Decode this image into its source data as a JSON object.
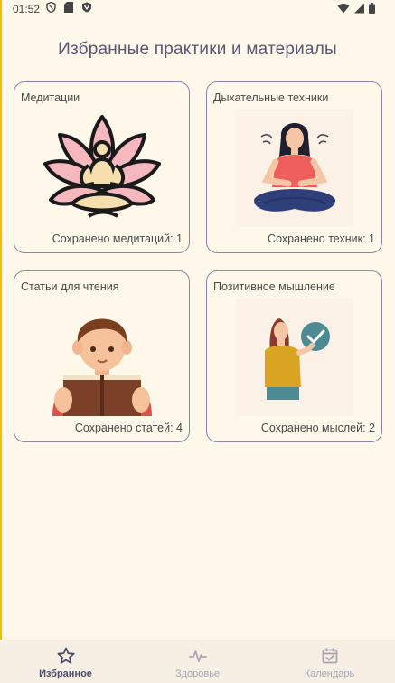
{
  "status": {
    "time": "01:52"
  },
  "page": {
    "title": "Избранные практики и материалы"
  },
  "cards": [
    {
      "title": "Медитации",
      "count": "Сохранено медитаций: 1",
      "icon": "lotus-meditation-icon"
    },
    {
      "title": "Дыхательные техники",
      "count": "Сохранено техник: 1",
      "icon": "breathing-woman-icon"
    },
    {
      "title": "Статьи для чтения",
      "count": "Сохранено статей: 4",
      "icon": "reading-boy-icon"
    },
    {
      "title": "Позитивное мышление",
      "count": "Сохранено мыслей: 2",
      "icon": "positive-woman-icon"
    }
  ],
  "nav": {
    "items": [
      {
        "label": "Избранное",
        "icon": "star-icon",
        "active": true
      },
      {
        "label": "Здоровье",
        "icon": "pulse-icon",
        "active": false
      },
      {
        "label": "Календарь",
        "icon": "calendar-check-icon",
        "active": false
      }
    ]
  },
  "colors": {
    "background": "#fdf8ea",
    "card_border": "#8a86a8",
    "title": "#5a5676",
    "nav_active": "#4e4a6a",
    "nav_inactive": "#a9a4b4"
  }
}
